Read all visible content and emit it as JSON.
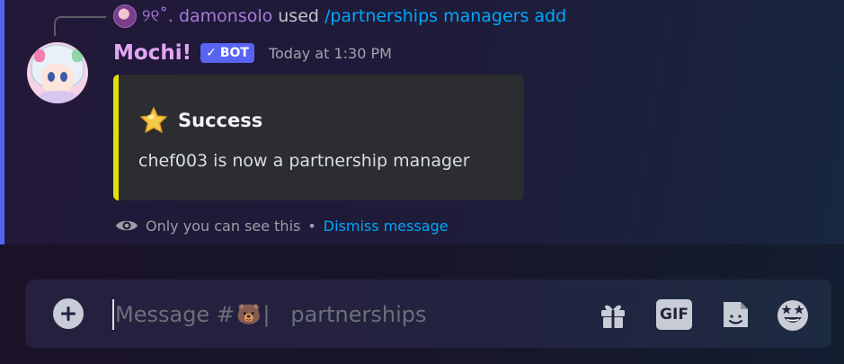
{
  "reply": {
    "username": "୨୧˚. damonsolo",
    "used_text": "used",
    "command": "/partnerships managers add"
  },
  "message": {
    "author": "Mochi!",
    "bot_tag": "BOT",
    "timestamp": "Today at 1:30 PM"
  },
  "embed": {
    "title": "Success",
    "description": "chef003 is now a partnership manager",
    "accent_color": "#e2e000",
    "title_icon": "star-icon"
  },
  "ephemeral": {
    "note": "Only you can see this",
    "separator": "•",
    "dismiss_label": "Dismiss message"
  },
  "composer": {
    "placeholder_prefix": "Message #",
    "placeholder_emoji": "🐻",
    "placeholder_divider": "|",
    "placeholder_channel": "partnerships",
    "gif_label": "GIF",
    "icons": [
      "plus-icon",
      "gift-icon",
      "gif-icon",
      "sticker-icon",
      "emoji-icon"
    ]
  },
  "colors": {
    "blurple": "#5865f2",
    "link": "#00a8fc",
    "bot_name": "#e3a6f3"
  }
}
